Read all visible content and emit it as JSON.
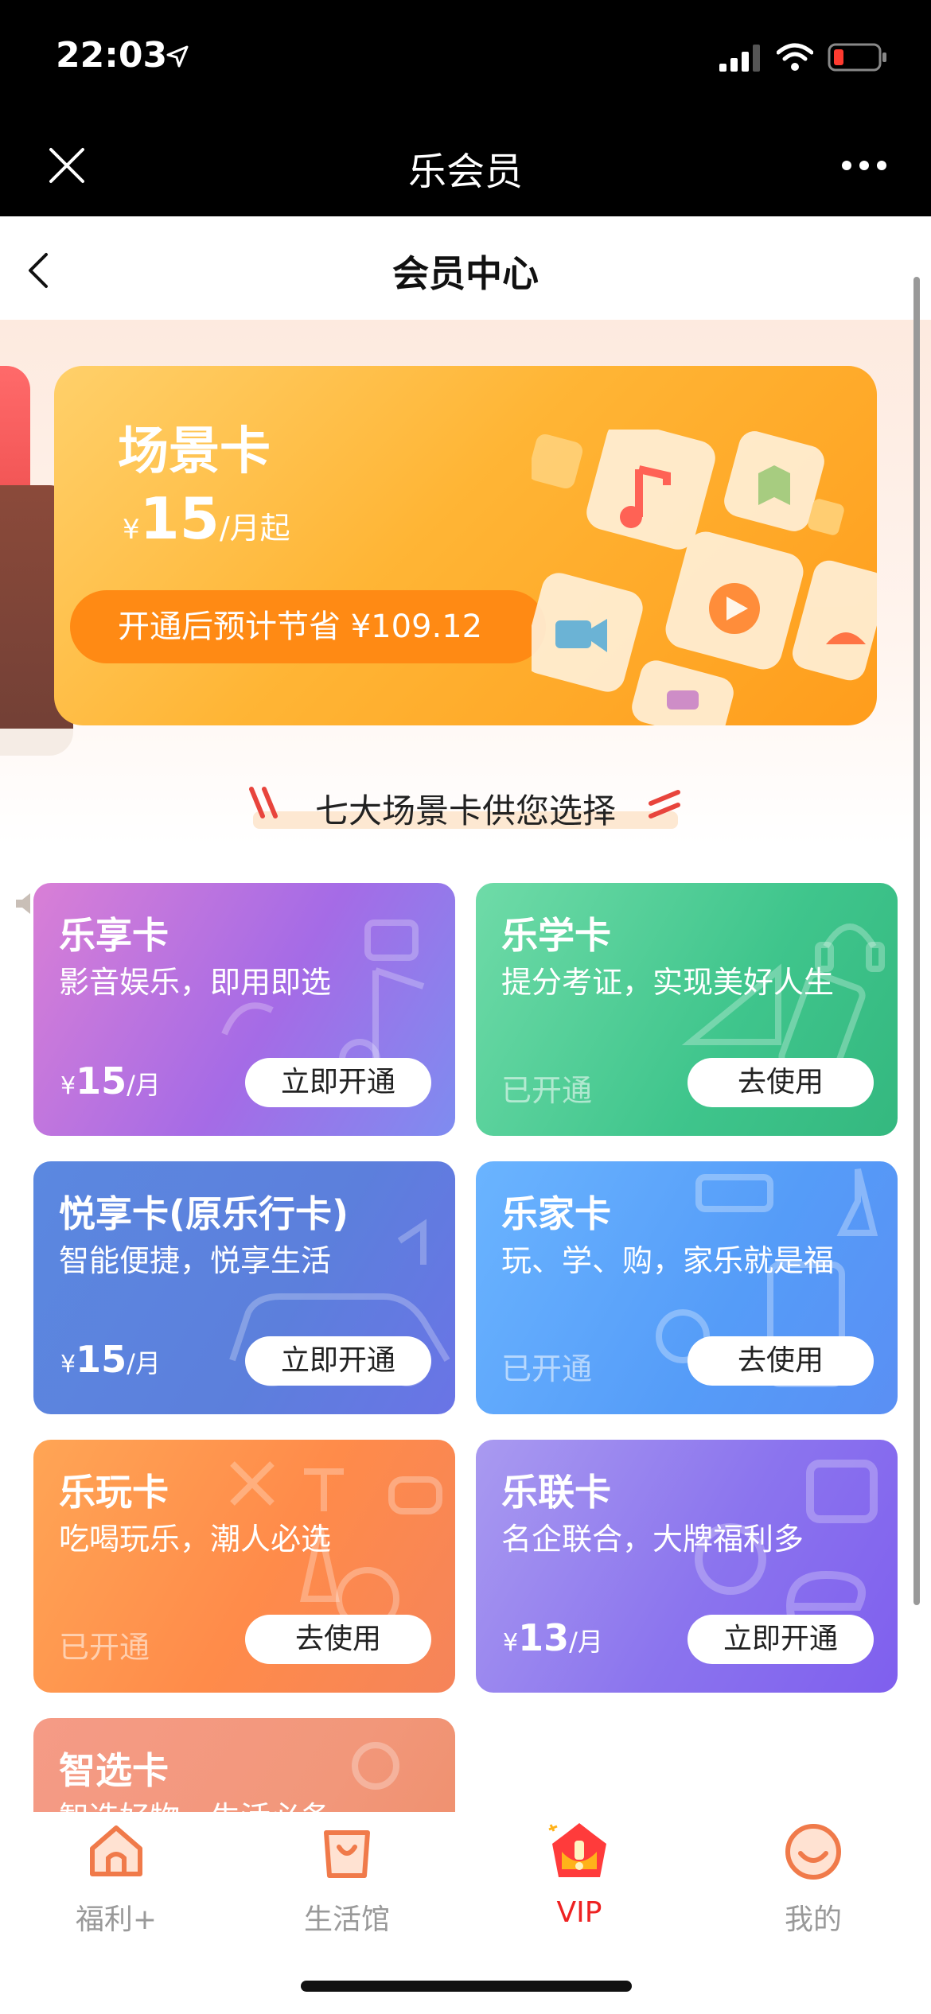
{
  "status_bar": {
    "time": "22:03"
  },
  "nav_bar": {
    "title": "乐会员"
  },
  "page": {
    "title": "会员中心"
  },
  "scene_card": {
    "title": "场景卡",
    "price_symbol": "¥",
    "price": "15",
    "price_unit": "/月起",
    "save_text": "开通后预计节省 ¥109.12"
  },
  "section_title": "七大场景卡供您选择",
  "cards": [
    {
      "title": "乐享卡",
      "subtitle": "影音娱乐，即用即选",
      "price_symbol": "¥",
      "price": "15",
      "price_unit": "/月",
      "button": "立即开通"
    },
    {
      "title": "乐学卡",
      "subtitle": "提分考证，实现美好人生",
      "status": "已开通",
      "button": "去使用"
    },
    {
      "title": "悦享卡(原乐行卡)",
      "subtitle": "智能便捷，悦享生活",
      "price_symbol": "¥",
      "price": "15",
      "price_unit": "/月",
      "button": "立即开通"
    },
    {
      "title": "乐家卡",
      "subtitle": "玩、学、购，家乐就是福",
      "status": "已开通",
      "button": "去使用"
    },
    {
      "title": "乐玩卡",
      "subtitle": "吃喝玩乐，潮人必选",
      "status": "已开通",
      "button": "去使用"
    },
    {
      "title": "乐联卡",
      "subtitle": "名企联合，大牌福利多",
      "price_symbol": "¥",
      "price": "13",
      "price_unit": "/月",
      "button": "立即开通"
    },
    {
      "title": "智选卡",
      "subtitle": "智选好物，生活必备"
    }
  ],
  "tabs": [
    {
      "label": "福利+",
      "icon": "home-icon"
    },
    {
      "label": "生活馆",
      "icon": "shopping-bag-icon"
    },
    {
      "label": "VIP",
      "icon": "crown-icon",
      "active": true
    },
    {
      "label": "我的",
      "icon": "smiley-icon"
    }
  ],
  "colors": {
    "accent": "#ee2222",
    "scene_orange": "#ff9d1c",
    "inactive": "#999999"
  }
}
